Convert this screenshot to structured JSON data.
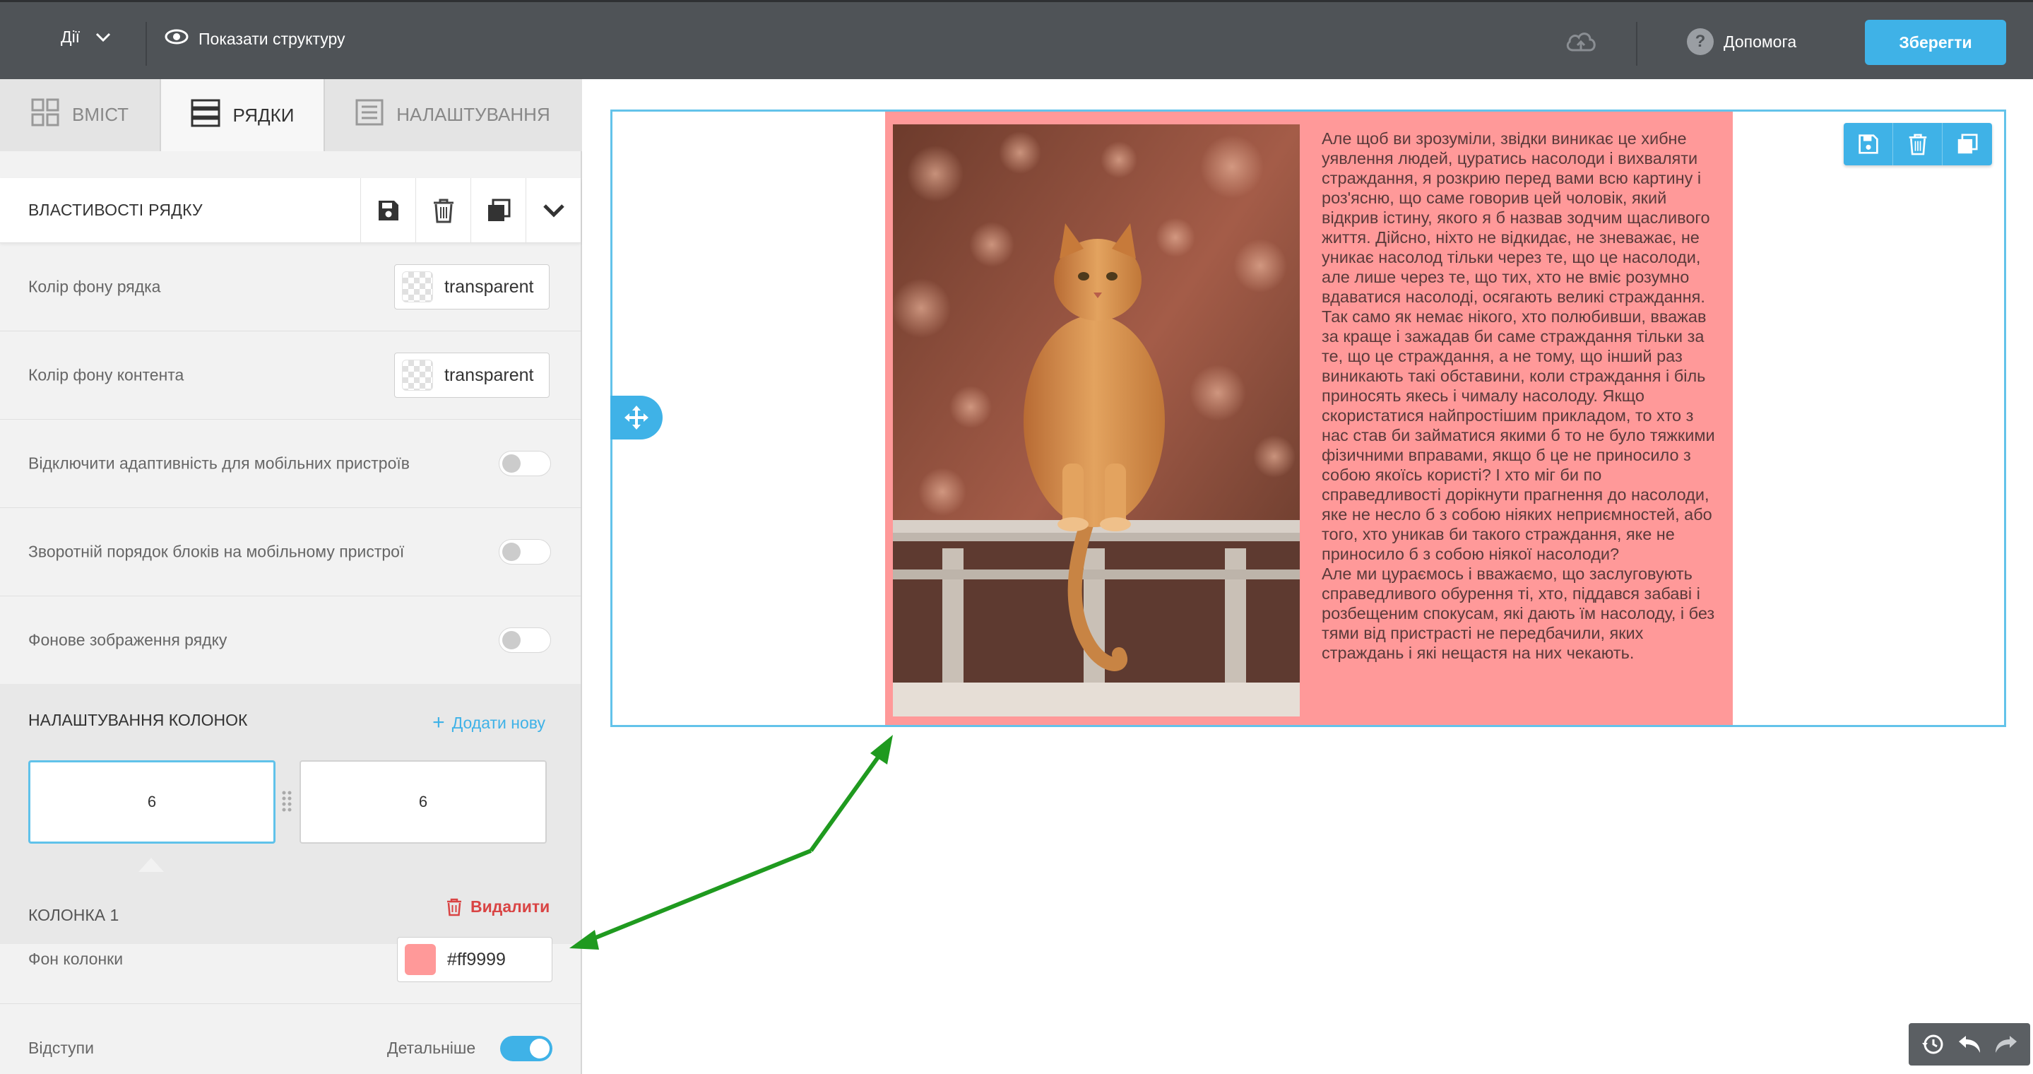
{
  "topbar": {
    "actions_label": "Дії",
    "show_structure_label": "Показати структуру",
    "help_label": "Допомога",
    "save_label": "Зберегти"
  },
  "tabs": [
    {
      "label": "ВМІСТ",
      "active": false
    },
    {
      "label": "РЯДКИ",
      "active": true
    },
    {
      "label": "НАЛАШТУВАННЯ",
      "active": false
    }
  ],
  "row_properties": {
    "title": "ВЛАСТИВОСТІ РЯДКУ",
    "row_bg": {
      "label": "Колір фону рядка",
      "value": "transparent"
    },
    "content_bg": {
      "label": "Колір фону контента",
      "value": "transparent"
    },
    "disable_mobile": {
      "label": "Відключити адаптивність для мобільних пристроїв",
      "on": false
    },
    "reverse_order": {
      "label": "Зворотній порядок блоків на мобільному пристрої",
      "on": false
    },
    "bg_image": {
      "label": "Фонове зображення рядку",
      "on": false
    }
  },
  "column_settings": {
    "title": "НАЛАШТУВАННЯ КОЛОНОК",
    "add_new_label": "Додати нову",
    "columns": [
      "6",
      "6"
    ]
  },
  "column1": {
    "title": "КОЛОНКА 1",
    "delete_label": "Видалити",
    "bg_label": "Фон колонки",
    "bg_value": "#ff9999",
    "margins_label": "Відступи",
    "details_label": "Детальніше",
    "details_on": true
  },
  "canvas": {
    "column_color": "#ff9999",
    "accent_color": "#3fb2e7",
    "paragraph1": "Але щоб ви зрозуміли, звідки виникає це хибне уявлення людей, цуратись насолоди і вихваляти страждання, я розкрию перед вами всю картину і роз'ясню, що саме говорив цей чоловік, який відкрив істину, якого я б назвав зодчим щасливого життя. Дійсно, ніхто не відкидає, не зневажає, не уникає насолод тільки через те, що це насолоди, але лише через те, що тих, хто не вміє розумно вдаватися насолоді, осягають великі страждання. Так само як немає нікого, хто полюбивши, вважав за краще і зажадав би саме страждання тільки за те, що це страждання, а не тому, що інший раз виникають такі обставини, коли страждання і біль приносять якесь і чималу насолоду. Якщо скористатися найпростішим прикладом, то хто з нас став би займатися якими б то не було тяжкими фізичними вправами, якщо б це не приносило з собою якоїсь користі? І хто міг би по справедливості дорікнути прагнення до насолоди, яке не несло б з собою ніяких неприємностей, або того, хто уникав би такого страждання, яке не приносило б з собою ніякої насолоди?",
    "paragraph2": "Але ми цураємось і вважаємо, що заслуговують справедливого обурення ті, хто, піддався забаві і розбещеним спокусам, які дають їм насолоду, і без тями від пристрасті не передбачили, яких страждань і які нещастя на них чекають."
  },
  "icons": [
    "chevron-down-icon",
    "eye-icon",
    "cloud-upload-icon",
    "help-icon",
    "grid-icon",
    "rows-icon",
    "settings-list-icon",
    "save-icon",
    "trash-icon",
    "duplicate-icon",
    "move-icon",
    "history-icon",
    "undo-icon",
    "redo-icon",
    "plus-icon"
  ]
}
